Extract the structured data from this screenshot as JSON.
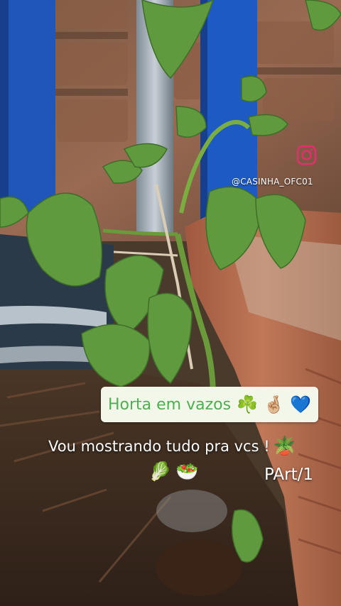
{
  "overlay": {
    "handle": "@CASINHA_OFC01",
    "title": "Horta em vazos",
    "title_emojis": "☘️ 🤞🏼 💙",
    "subtitle": "Vou mostrando tudo pra vcs !",
    "subtitle_emoji": "🪴",
    "food_emojis": "🥬🥗",
    "part": "PArt/1"
  },
  "colors": {
    "title_text": "#4caf50",
    "title_bg": "#f3f7ea",
    "overlay_text": "#ffffff",
    "instagram_icon": "#e1306c"
  },
  "icons": [
    "instagram-icon"
  ]
}
